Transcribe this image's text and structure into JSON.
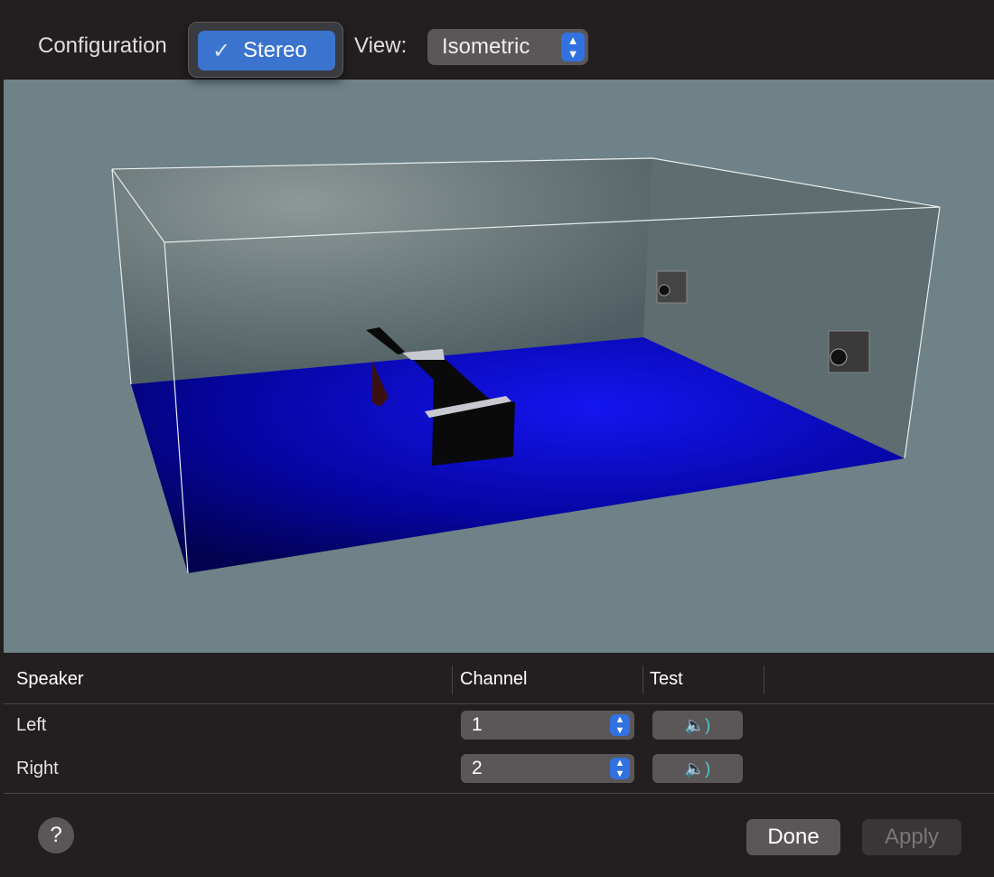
{
  "toolbar": {
    "configuration_label": "Configuration",
    "configuration_selected": "Stereo",
    "view_label": "View:",
    "view_selected": "Isometric"
  },
  "table": {
    "headers": [
      "Speaker",
      "Channel",
      "Test"
    ],
    "rows": [
      {
        "speaker": "Left",
        "channel": "1"
      },
      {
        "speaker": "Right",
        "channel": "2"
      }
    ]
  },
  "footer": {
    "help": "?",
    "done": "Done",
    "apply": "Apply"
  },
  "colors": {
    "accent": "#3b74cf",
    "floor": "#0a0ad0",
    "scene_bg": "#6e8287"
  }
}
